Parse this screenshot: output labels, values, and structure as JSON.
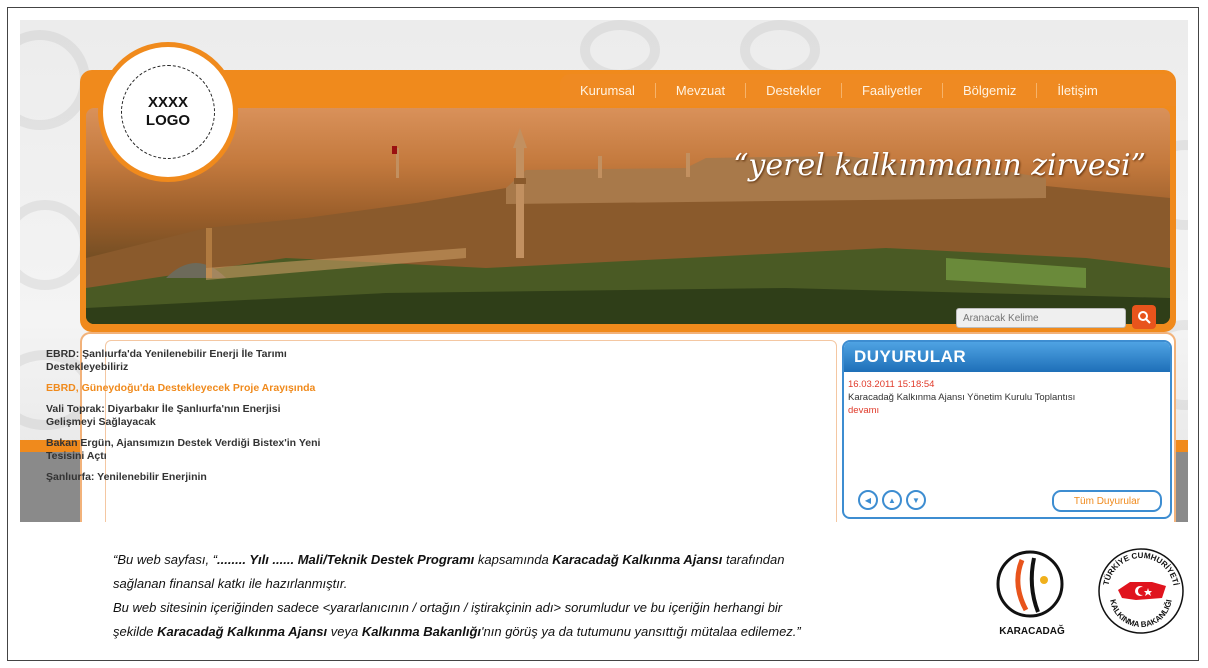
{
  "logo": {
    "text": "XXXX\nLOGO"
  },
  "nav": {
    "items": [
      "Kurumsal",
      "Mevzuat",
      "Destekler",
      "Faaliyetler",
      "Bölgemiz",
      "İletişim"
    ]
  },
  "banner": {
    "slogan": "“yerel kalkınmanın zirvesi”"
  },
  "search": {
    "placeholder": "Aranacak Kelime"
  },
  "news": {
    "items": [
      "EBRD: Şanlıurfa'da Yenilenebilir Enerji İle Tarımı Destekleyebiliriz",
      "EBRD, Güneydoğu'da Destekleyecek Proje Arayışında",
      "Vali Toprak: Diyarbakır İle Şanlıurfa'nın Enerjisi Gelişmeyi Sağlayacak",
      "Bakan Ergün, Ajansımızın Destek Verdiği Bistex'in Yeni Tesisini Açtı",
      "Şanlıurfa: Yenilenebilir Enerjinin"
    ]
  },
  "announcements": {
    "title": "DUYURULAR",
    "date": "16.03.2011 15:18:54",
    "text": "Karacadağ Kalkınma Ajansı Yönetim Kurulu Toplantısı",
    "more": "devamı",
    "all_label": "Tüm Duyurular"
  },
  "disclaimer": {
    "p1_a": "“Bu web sayfası, “",
    "p1_b": "........ Yılı ...... Mali/Teknik Destek Programı",
    "p1_c": " kapsamında ",
    "p1_d": "Karacadağ Kalkınma Ajansı",
    "p1_e": " tarafından",
    "p2": "sağlanan finansal katkı ile hazırlanmıştır.",
    "p3": "Bu web sitesinin içeriğinden sadece <yararlanıcının / ortağın / iştirakçinin adı> sorumludur ve bu içeriğin herhangi bir",
    "p4_a": "şekilde ",
    "p4_b": "Karacadağ Kalkınma Ajansı",
    "p4_c": " veya ",
    "p4_d": "Kalkınma Bakanlığı",
    "p4_e": "'nın görüş ya da tutumunu yansıttığı mütalaa edilemez.”"
  },
  "logos": {
    "karacadag": "KARACADAĞ",
    "bakanlik_top": "TÜRKİYE CUMHURİYETİ",
    "bakanlik_bottom": "KALKINMA BAKANLIĞI"
  },
  "colors": {
    "orange": "#f08a1c",
    "blue": "#1e6fb8",
    "red": "#e03a2a"
  }
}
